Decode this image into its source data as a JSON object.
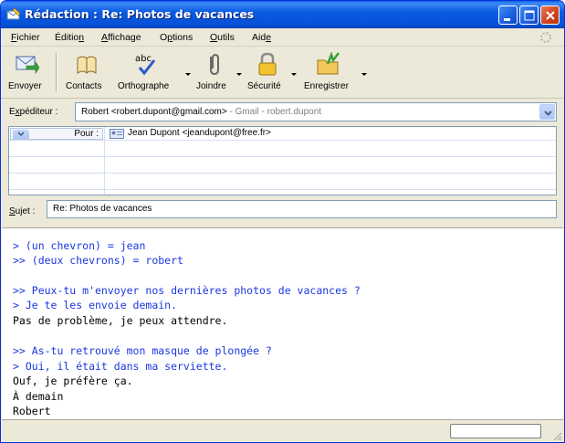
{
  "window": {
    "title": "Rédaction : Re: Photos de vacances",
    "icon": "compose-mail-icon"
  },
  "menu": {
    "items": [
      {
        "pre": "",
        "u": "F",
        "post": "ichier"
      },
      {
        "pre": "Éditio",
        "u": "n",
        "post": ""
      },
      {
        "pre": "",
        "u": "A",
        "post": "ffichage"
      },
      {
        "pre": "O",
        "u": "p",
        "post": "tions"
      },
      {
        "pre": "",
        "u": "O",
        "post": "utils"
      },
      {
        "pre": "Aid",
        "u": "e",
        "post": ""
      }
    ]
  },
  "toolbar": {
    "send": "Envoyer",
    "contacts": "Contacts",
    "spelling": "Orthographe",
    "attach": "Joindre",
    "security": "Sécurité",
    "save": "Enregistrer",
    "spell_icon_text": "abc"
  },
  "header": {
    "from_label_pre": "E",
    "from_label_u": "x",
    "from_label_post": "péditeur :",
    "from_value": "Robert <robert.dupont@gmail.com>",
    "from_account": " - Gmail - robert.dupont",
    "to_label": "Pour :",
    "to_value": "Jean Dupont <jeandupont@free.fr>",
    "subject_label_pre": "",
    "subject_label_u": "S",
    "subject_label_post": "ujet :",
    "subject_value": "Re: Photos de vacances"
  },
  "body": {
    "lines": [
      {
        "text": "> (un chevron) = jean",
        "quoted": true
      },
      {
        "text": ">> (deux chevrons) = robert",
        "quoted": true
      },
      {
        "text": "",
        "quoted": false
      },
      {
        "text": ">> Peux-tu m'envoyer nos dernières photos de vacances ?",
        "quoted": true
      },
      {
        "text": "> Je te les envoie demain.",
        "quoted": true
      },
      {
        "text": "Pas de problème, je peux attendre.",
        "quoted": false
      },
      {
        "text": "",
        "quoted": false
      },
      {
        "text": ">> As-tu retrouvé mon masque de plongée ?",
        "quoted": true
      },
      {
        "text": "> Oui, il était dans ma serviette.",
        "quoted": true
      },
      {
        "text": "Ouf, je préfère ça.",
        "quoted": false
      },
      {
        "text": "À demain",
        "quoted": false
      },
      {
        "text": "Robert",
        "quoted": false
      }
    ]
  },
  "colors": {
    "quote": "#1a37e0",
    "titlebar": "#0551d6"
  }
}
